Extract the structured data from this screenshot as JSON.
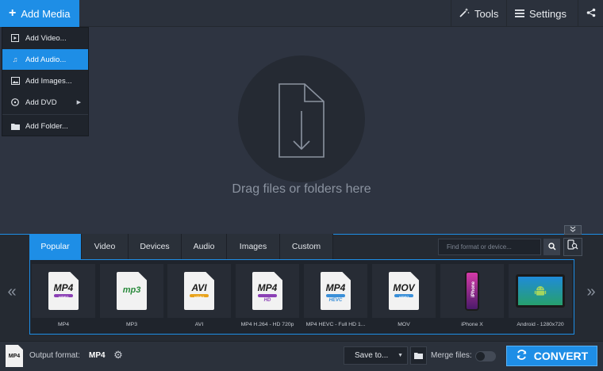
{
  "toolbar": {
    "add_media_label": "Add Media",
    "tools_label": "Tools",
    "settings_label": "Settings"
  },
  "add_menu": {
    "items": [
      {
        "label": "Add Video...",
        "icon": "video-icon"
      },
      {
        "label": "Add Audio...",
        "icon": "music-note-icon",
        "active": true
      },
      {
        "label": "Add Images...",
        "icon": "image-icon"
      },
      {
        "label": "Add DVD",
        "icon": "dvd-icon",
        "has_submenu": true
      },
      {
        "label": "Add Folder...",
        "icon": "folder-icon"
      }
    ]
  },
  "drop_area": {
    "text": "Drag files or folders here",
    "icon": "file-download-icon"
  },
  "format_panel": {
    "tabs": [
      "Popular",
      "Video",
      "Devices",
      "Audio",
      "Images",
      "Custom"
    ],
    "active_tab": "Popular",
    "search_placeholder": "Find format or device...",
    "formats": [
      {
        "label": "MP4",
        "icon_text": "MP4",
        "sub": "VIDEO"
      },
      {
        "label": "MP3",
        "icon_text": "mp3",
        "sub": ""
      },
      {
        "label": "AVI",
        "icon_text": "AVI",
        "sub": "VIDEO"
      },
      {
        "label": "MP4 H.264 - HD 720p",
        "icon_text": "MP4",
        "sub": "HD"
      },
      {
        "label": "MP4 HEVC - Full HD 1...",
        "icon_text": "MP4",
        "sub": "HEVC"
      },
      {
        "label": "MOV",
        "icon_text": "MOV",
        "sub": "VIDEO"
      },
      {
        "label": "iPhone X",
        "icon_text": "iPhone",
        "sub": ""
      },
      {
        "label": "Android - 1280x720",
        "icon_text": "",
        "sub": ""
      }
    ]
  },
  "status": {
    "output_label": "Output format:",
    "output_value": "MP4",
    "output_icon_text": "MP4",
    "save_to_label": "Save to...",
    "merge_label": "Merge files:",
    "merge_on": false,
    "convert_label": "CONVERT"
  },
  "colors": {
    "accent": "#1e8ee6",
    "background": "#2e3441"
  }
}
